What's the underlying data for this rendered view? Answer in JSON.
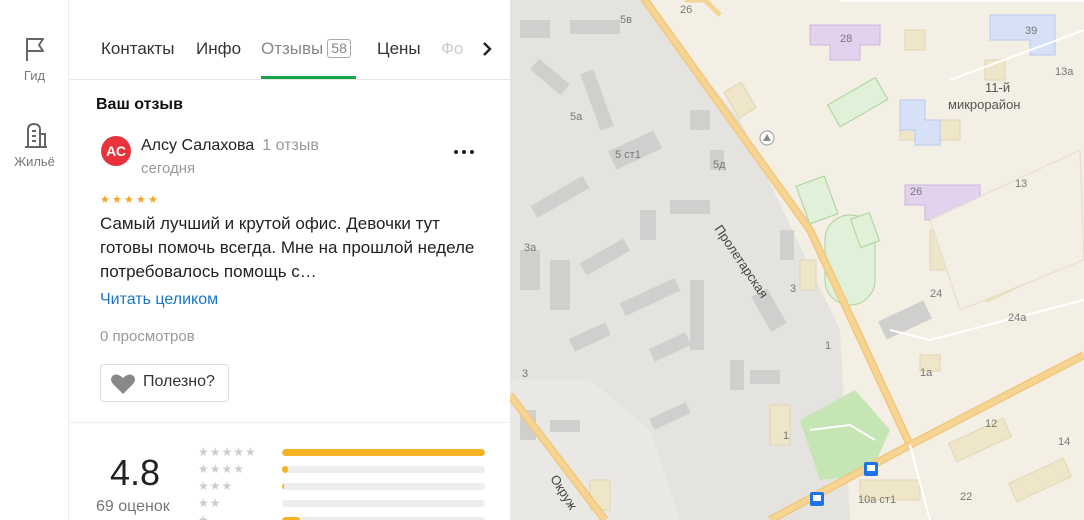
{
  "rail": {
    "items": [
      {
        "label": "Гид",
        "icon": "flag-icon"
      },
      {
        "label": "Жильё",
        "icon": "building-icon"
      }
    ]
  },
  "tabs": {
    "items": [
      {
        "label": "Контакты"
      },
      {
        "label": "Инфо"
      },
      {
        "label": "Отзывы",
        "count": "58",
        "active": true
      },
      {
        "label": "Цены"
      },
      {
        "label": "Фо"
      }
    ]
  },
  "review": {
    "section_title": "Ваш отзыв",
    "avatar_initials": "АС",
    "avatar_color": "#e8323c",
    "author": "Алсу Салахова",
    "author_reviews": "1 отзыв",
    "date": "сегодня",
    "stars": 5,
    "text": "Самый лучший и крутой офис. Девочки тут готовы помочь всегда. Мне на прошлой неделе потребовалось помощь с…",
    "read_more": "Читать целиком",
    "views": "0 просмотров",
    "useful_label": "Полезно?"
  },
  "rating": {
    "value": "4.8",
    "count": "69 оценок",
    "distribution": [
      {
        "stars": 5,
        "fraction": 1.0
      },
      {
        "stars": 4,
        "fraction": 0.03
      },
      {
        "stars": 3,
        "fraction": 0.01
      },
      {
        "stars": 2,
        "fraction": 0.0
      },
      {
        "stars": 1,
        "fraction": 0.09
      }
    ]
  },
  "map": {
    "street_labels": [
      "Пролетарская",
      "Окруж"
    ],
    "district_label_1": "11-й",
    "district_label_2": "микрорайон",
    "house_numbers": [
      "5в",
      "26",
      "28",
      "39",
      "13а",
      "5а",
      "5 ст1",
      "5д",
      "26",
      "13",
      "3а",
      "24",
      "24а",
      "3",
      "1",
      "1а",
      "3",
      "1",
      "12",
      "14",
      "10а ст1",
      "22"
    ]
  }
}
